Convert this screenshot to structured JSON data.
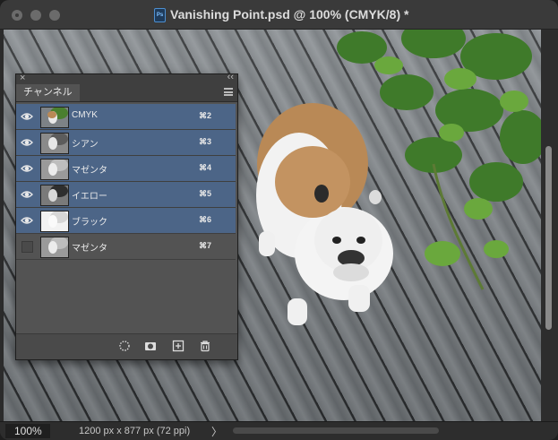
{
  "window": {
    "title": "Vanishing Point.psd @ 100% (CMYK/8) *",
    "doc_icon": "Ps"
  },
  "status": {
    "zoom": "100%",
    "doc_info": "1200 px x 877 px (72 ppi)",
    "arrow": "〉"
  },
  "panel": {
    "tab": "チャンネル",
    "close": "×",
    "collapse": "‹‹",
    "channels": [
      {
        "name": "CMYK",
        "shortcut": "⌘2",
        "visible": true,
        "selected": true
      },
      {
        "name": "シアン",
        "shortcut": "⌘3",
        "visible": true,
        "selected": true
      },
      {
        "name": "マゼンタ",
        "shortcut": "⌘4",
        "visible": true,
        "selected": true
      },
      {
        "name": "イエロー",
        "shortcut": "⌘5",
        "visible": true,
        "selected": true
      },
      {
        "name": "ブラック",
        "shortcut": "⌘6",
        "visible": true,
        "selected": true
      },
      {
        "name": "マゼンタ",
        "shortcut": "⌘7",
        "visible": false,
        "selected": false
      }
    ],
    "footer_icons": [
      "dotted-circle-icon",
      "mask-icon",
      "new-channel-icon",
      "trash-icon"
    ]
  },
  "colors": {
    "selected_row": "#4c6587",
    "panel_bg": "#535353"
  }
}
